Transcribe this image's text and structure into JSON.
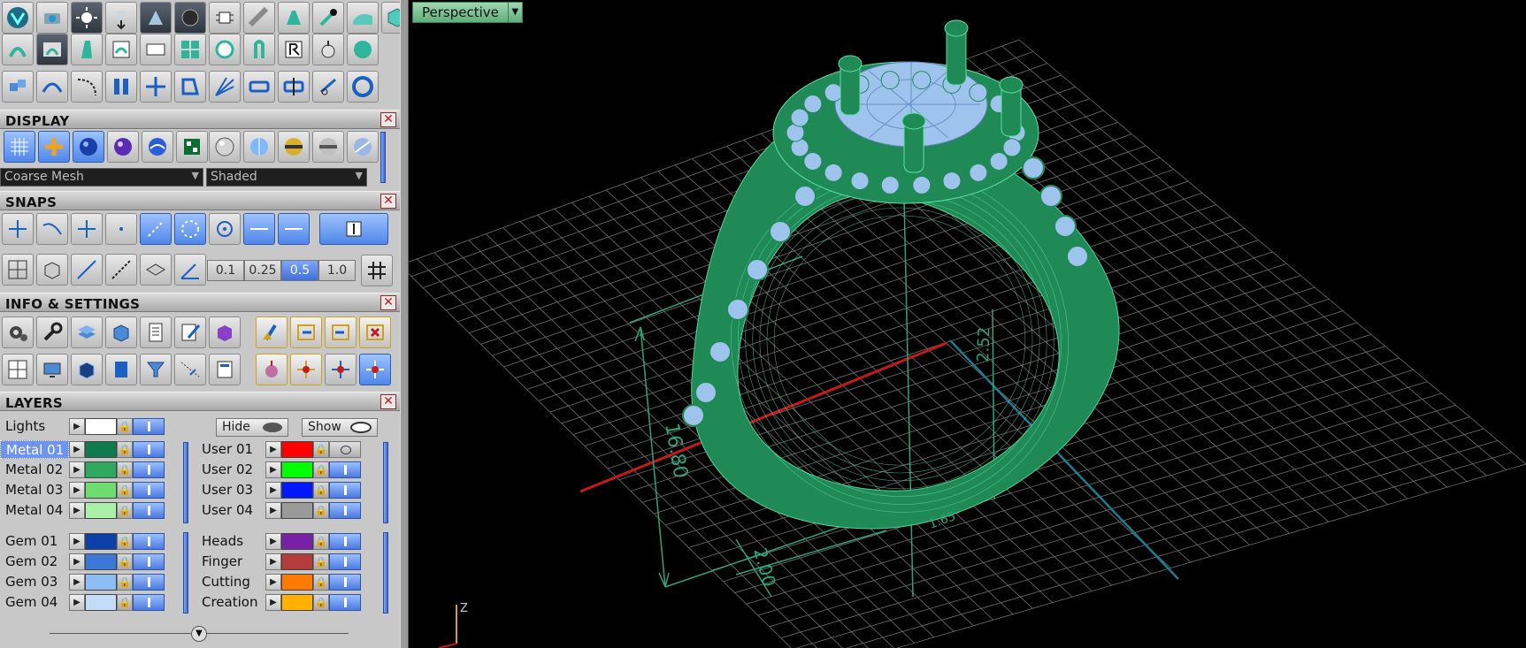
{
  "display": {
    "title": "DISPLAY",
    "mesh_select": "Coarse Mesh",
    "shade_select": "Shaded"
  },
  "snaps": {
    "title": "SNAPS",
    "grid_values": [
      "0.1",
      "0.25",
      "0.5",
      "1.0"
    ],
    "grid_active": "0.5"
  },
  "info": {
    "title": "INFO & SETTINGS"
  },
  "layers": {
    "title": "LAYERS",
    "lights_label": "Lights",
    "hide_label": "Hide",
    "show_label": "Show",
    "left": [
      {
        "name": "Metal 01",
        "color": "#0f7a4f",
        "selected": true
      },
      {
        "name": "Metal 02",
        "color": "#2fa860"
      },
      {
        "name": "Metal 03",
        "color": "#6fdc6f"
      },
      {
        "name": "Metal 04",
        "color": "#a9f0a9"
      },
      {
        "name": "Gem 01",
        "color": "#0d3fa8"
      },
      {
        "name": "Gem 02",
        "color": "#3d78d8"
      },
      {
        "name": "Gem 03",
        "color": "#8dbdf5"
      },
      {
        "name": "Gem 04",
        "color": "#c3dcf8"
      }
    ],
    "right": [
      {
        "name": "User 01",
        "color": "#ff0000",
        "visible": false
      },
      {
        "name": "User 02",
        "color": "#00ff00"
      },
      {
        "name": "User 03",
        "color": "#0018ff"
      },
      {
        "name": "User 04",
        "color": "#9a9a9a"
      },
      {
        "name": "Heads",
        "color": "#7a1fa8"
      },
      {
        "name": "Finger",
        "color": "#b43c3c"
      },
      {
        "name": "Cutting",
        "color": "#ff7a00"
      },
      {
        "name": "Creation",
        "color": "#ffb000"
      }
    ]
  },
  "viewport": {
    "label": "Perspective",
    "dim_height": "16.80",
    "dim_width": "2.00",
    "dim_depth": "2.52",
    "dim_small": "1.65",
    "axis_z": "Z",
    "colors": {
      "model": "#1f8a55",
      "gem": "#9ec4ee",
      "grid": "#6e6e6e",
      "x_axis": "#c81818",
      "y_axis": "#1d7c92"
    }
  }
}
